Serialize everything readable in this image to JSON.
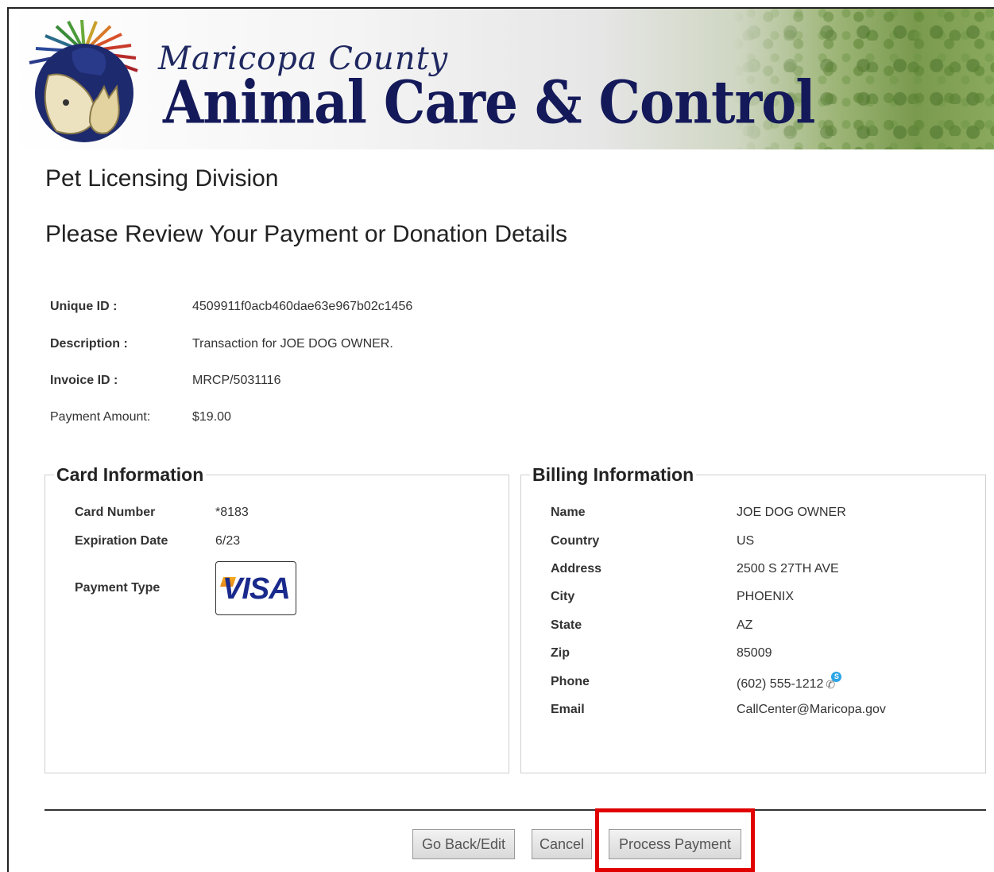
{
  "header": {
    "county_name": "Maricopa County",
    "agency_name": "Animal Care & Control"
  },
  "page": {
    "division": "Pet Licensing Division",
    "heading": "Please Review Your Payment or Donation Details"
  },
  "summary": {
    "unique_id_label": "Unique ID :",
    "unique_id": "4509911f0acb460dae63e967b02c1456",
    "description_label": "Description :",
    "description": "Transaction for JOE DOG OWNER.",
    "invoice_label": "Invoice ID :",
    "invoice_id": "MRCP/5031116",
    "amount_label": "Payment Amount:",
    "amount": "$19.00"
  },
  "card": {
    "legend": "Card Information",
    "number_label": "Card Number",
    "number": "*8183",
    "expiration_label": "Expiration Date",
    "expiration": "6/23",
    "type_label": "Payment Type",
    "type_logo_text": "VISA"
  },
  "billing": {
    "legend": "Billing Information",
    "name_label": "Name",
    "name": "JOE DOG OWNER",
    "country_label": "Country",
    "country": "US",
    "address_label": "Address",
    "address": "2500 S 27TH AVE",
    "city_label": "City",
    "city": "PHOENIX",
    "state_label": "State",
    "state": "AZ",
    "zip_label": "Zip",
    "zip": "85009",
    "phone_label": "Phone",
    "phone": "(602) 555-1212",
    "email_label": "Email",
    "email": "CallCenter@Maricopa.gov"
  },
  "buttons": {
    "back": "Go Back/Edit",
    "cancel": "Cancel",
    "process": "Process Payment"
  },
  "icons": {
    "logo": "animal-care-logo-icon",
    "phone": "skype-call-icon",
    "card_brand": "visa-icon"
  },
  "colors": {
    "title_navy": "#14195a",
    "highlight_red": "#e00000",
    "skype_blue": "#2aa5e6"
  }
}
